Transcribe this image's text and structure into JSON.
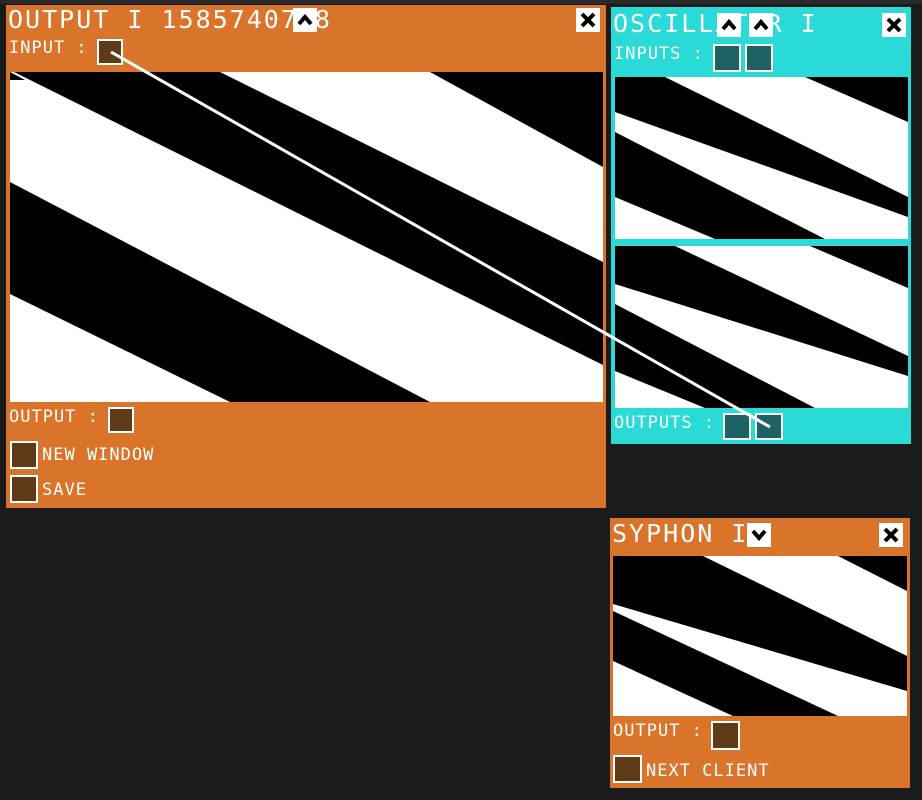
{
  "colors": {
    "background": "#1b1b1b",
    "output_window": "#d9742a",
    "oscillator_window": "#2adad6",
    "syphon_window": "#d9742a",
    "port_brown": "#5e3a18",
    "port_teal": "#1f6264",
    "connection": "#ffffff"
  },
  "output_window": {
    "title": "OUTPUT I 1585740778",
    "input_label": "INPUT :",
    "output_label": "OUTPUT :",
    "new_window_label": "NEW WINDOW",
    "save_label": "SAVE",
    "icons": [
      "chevron-up-icon",
      "close-icon"
    ]
  },
  "oscillator_window": {
    "title": "OSCILLATOR I",
    "inputs_label": "INPUTS :",
    "outputs_label": "OUTPUTS :",
    "icons": [
      "chevron-up-icon",
      "chevron-up-icon",
      "close-icon"
    ]
  },
  "syphon_window": {
    "title": "SYPHON I",
    "output_label": "OUTPUT :",
    "next_client_label": "NEXT CLIENT",
    "icons": [
      "chevron-down-icon",
      "close-icon"
    ]
  }
}
